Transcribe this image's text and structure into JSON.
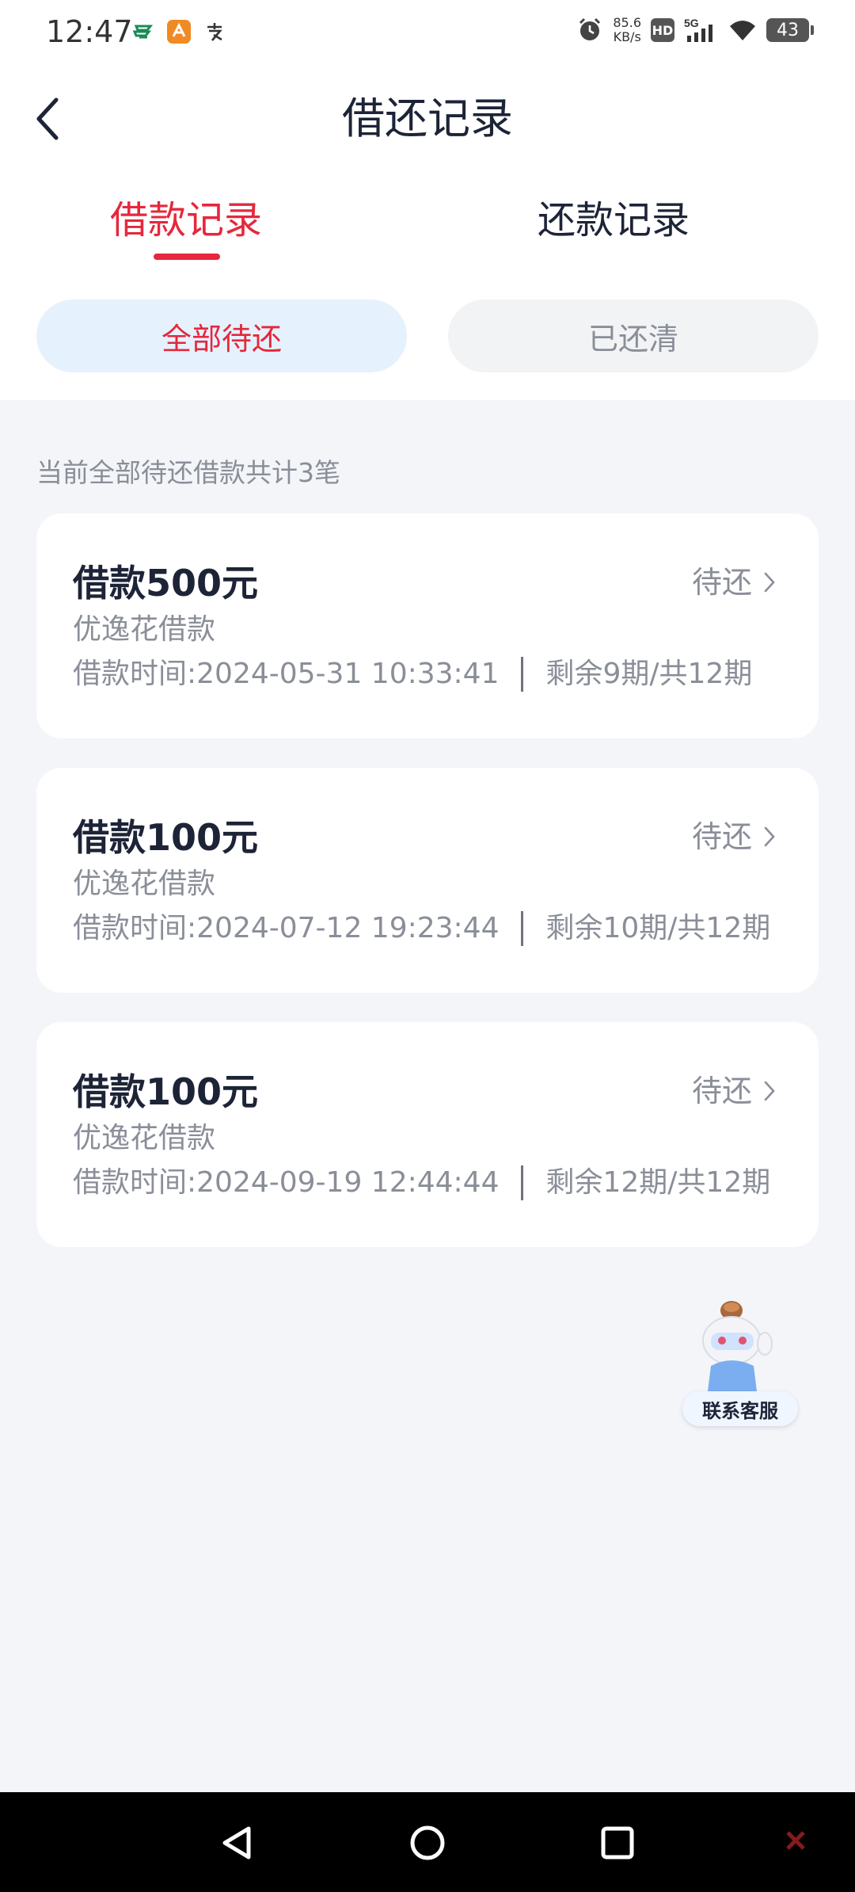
{
  "status_bar": {
    "time": "12:47",
    "speed_value": "85.6",
    "speed_unit": "KB/s",
    "hd": "HD",
    "network": "5G",
    "battery": "43",
    "left_icons": [
      "china-post-icon",
      "app-icon",
      "alipay-icon"
    ],
    "right_icons": [
      "alarm-icon",
      "hd-icon",
      "signal-icon",
      "wifi-icon",
      "battery-icon"
    ]
  },
  "header": {
    "title": "借还记录",
    "back_icon": "chevron-left-icon"
  },
  "tabs": [
    {
      "label": "借款记录",
      "active": true
    },
    {
      "label": "还款记录",
      "active": false
    }
  ],
  "filters": [
    {
      "label": "全部待还",
      "active": true
    },
    {
      "label": "已还清",
      "active": false
    }
  ],
  "summary": "当前全部待还借款共计3笔",
  "loans": [
    {
      "amount_prefix": "借款",
      "amount": "500",
      "amount_suffix": "元",
      "status": "待还",
      "product": "优逸花借款",
      "time": "借款时间:2024-05-31 10:33:41",
      "periods": "剩余9期/共12期"
    },
    {
      "amount_prefix": "借款",
      "amount": "100",
      "amount_suffix": "元",
      "status": "待还",
      "product": "优逸花借款",
      "time": "借款时间:2024-07-12 19:23:44",
      "periods": "剩余10期/共12期"
    },
    {
      "amount_prefix": "借款",
      "amount": "100",
      "amount_suffix": "元",
      "status": "待还",
      "product": "优逸花借款",
      "time": "借款时间:2024-09-19 12:44:44",
      "periods": "剩余12期/共12期"
    }
  ],
  "customer_service": {
    "label": "联系客服",
    "icon": "mascot-icon"
  },
  "nav_bar": {
    "icons": [
      "nav-back-icon",
      "nav-home-icon",
      "nav-recents-icon"
    ]
  },
  "colors": {
    "accent": "#e5283d",
    "pill_active_bg": "#e6f1fe",
    "text_primary": "#1d2437",
    "text_secondary": "#8a8e98",
    "page_bg": "#f3f5f8"
  }
}
